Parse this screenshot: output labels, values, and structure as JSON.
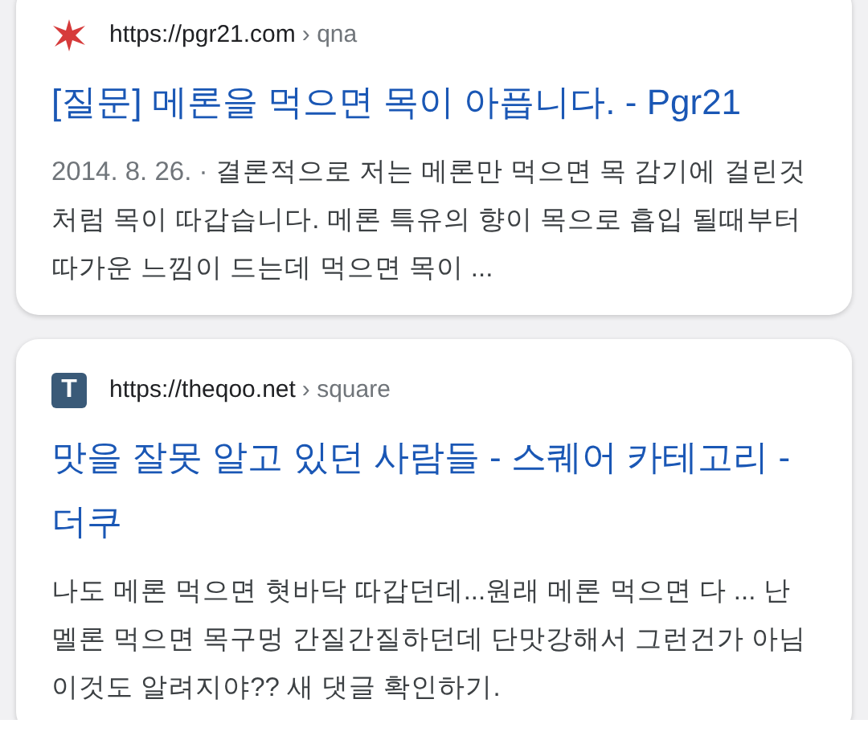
{
  "results": [
    {
      "favicon": {
        "kind": "star",
        "color": "#d63b3b"
      },
      "url": "https://pgr21.com",
      "path": "› qna",
      "title": "[질문] 메론을 먹으면 목이 아픕니다. - Pgr21",
      "date": "2014. 8. 26. · ",
      "snippet": "결론적으로 저는 메론만 먹으면 목 감기에 걸린것처럼 목이 따갑습니다. 메론 특유의 향이 목으로 흡입 될때부터 따가운 느낌이 드는데 먹으면 목이 ..."
    },
    {
      "favicon": {
        "kind": "letter",
        "letter": "T",
        "color": "#3a5a78"
      },
      "url": "https://theqoo.net",
      "path": "› square",
      "title": "맛을 잘못 알고 있던 사람들 - 스퀘어 카테고리 - 더쿠",
      "snippet": "나도 메론 먹으면 혓바닥 따갑던데...원래 메론 먹으면 다 ... 난 멜론 먹으면 목구멍 간질간질하던데 단맛강해서 그런건가 아님 이것도 알려지야?? 새 댓글 확인하기."
    }
  ]
}
